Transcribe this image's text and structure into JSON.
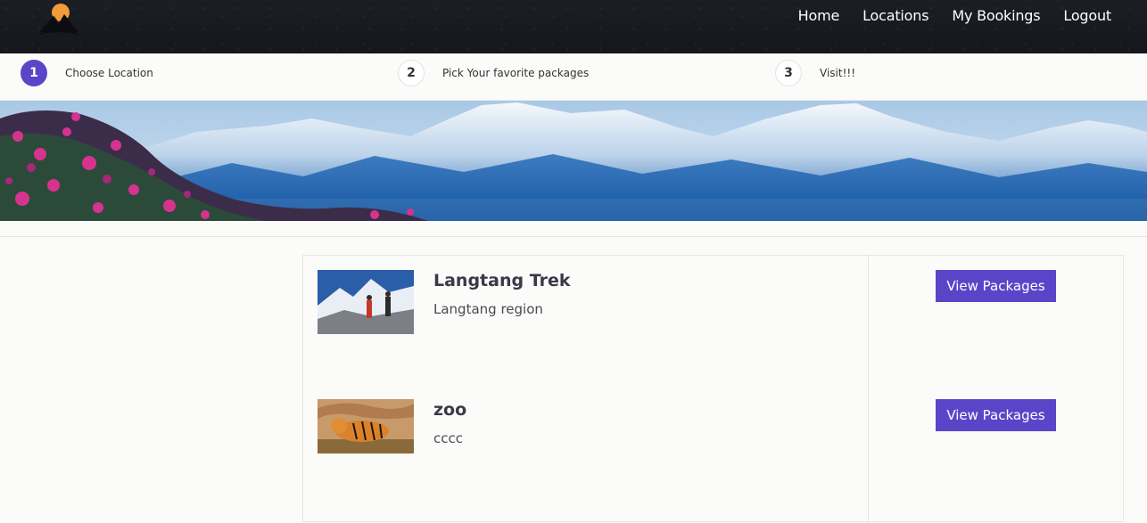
{
  "nav": {
    "links": [
      "Home",
      "Locations",
      "My Bookings",
      "Logout"
    ]
  },
  "steps": [
    {
      "number": "1",
      "label": "Choose Location",
      "active": true
    },
    {
      "number": "2",
      "label": "Pick Your favorite packages",
      "active": false
    },
    {
      "number": "3",
      "label": "Visit!!!",
      "active": false
    }
  ],
  "locations": [
    {
      "name": "Langtang Trek",
      "description": "Langtang region",
      "button": "View Packages"
    },
    {
      "name": "zoo",
      "description": "cccc",
      "button": "View Packages"
    }
  ],
  "colors": {
    "accent": "#5a45c8",
    "navbar": "#16191e"
  }
}
